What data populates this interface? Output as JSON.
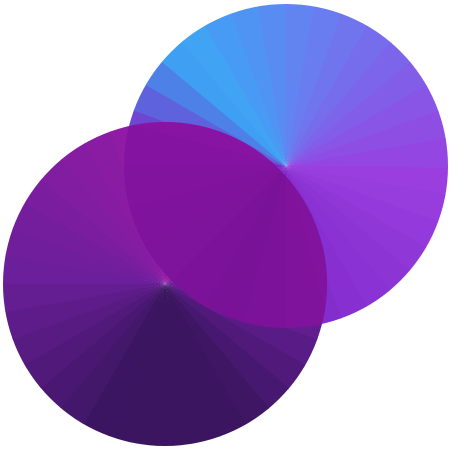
{
  "logo": {
    "icon": "overlapping-circles-logo",
    "colors": {
      "back_circle_blue": "#3aa8f5",
      "back_circle_violet": "#9a3ee0",
      "back_circle_purple": "#7d28c8",
      "front_circle_magenta": "#9a1aa8",
      "front_circle_purple": "#6b1f9a",
      "front_circle_dark": "#3b1560",
      "overlap_purple": "#8a14a6"
    }
  }
}
